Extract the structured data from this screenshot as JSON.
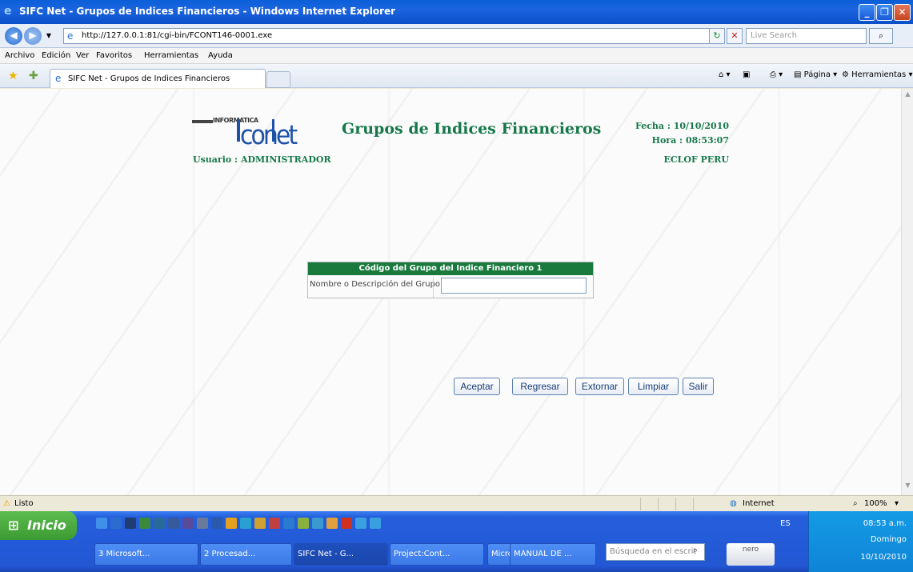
{
  "window": {
    "title": "SIFC Net - Grupos de Indices Financieros - Windows Internet Explorer"
  },
  "address": {
    "url": "http://127.0.0.1:81/cgi-bin/FCONT146-0001.exe",
    "search_placeholder": "Live Search"
  },
  "menu": [
    "Archivo",
    "Edición",
    "Ver",
    "Favoritos",
    "Herramientas",
    "Ayuda"
  ],
  "tab": {
    "label": "SIFC Net - Grupos de Indices Financieros"
  },
  "commandbar": {
    "page": "Página",
    "tools": "Herramientas"
  },
  "page": {
    "logo_top": "INFORMATICA",
    "logo_main": "conet",
    "title": "Grupos de Indices Financieros",
    "usuario": "Usuario : ADMINISTRADOR",
    "fecha": "Fecha : 10/10/2010",
    "hora": "Hora : 08:53:07",
    "empresa": "ECLOF PERU",
    "form": {
      "header": "Código del Grupo del Indice Financiero 1",
      "label": "Nombre o Descripción del Grupo",
      "value": ""
    },
    "buttons": [
      "Aceptar",
      "Regresar",
      "Extornar",
      "Limpiar",
      "Salir"
    ]
  },
  "status": {
    "text": "Listo",
    "zone": "Internet",
    "zoom": "100%"
  },
  "taskbar": {
    "start": "Inicio",
    "tasks": [
      "3 Microsoft...",
      "2 Procesad...",
      "SIFC Net - G...",
      "Project:Cont...",
      "Microsoft Ex...",
      "MANUAL DE ..."
    ],
    "search_placeholder": "Búsqueda en el escrit",
    "nero": "nero",
    "lang": "ES",
    "time": "08:53 a.m.",
    "day": "Domingo",
    "date": "10/10/2010"
  },
  "colors": {
    "accent_green": "#16784a",
    "header_green": "#1a7a3e",
    "xp_blue": "#245edb"
  }
}
